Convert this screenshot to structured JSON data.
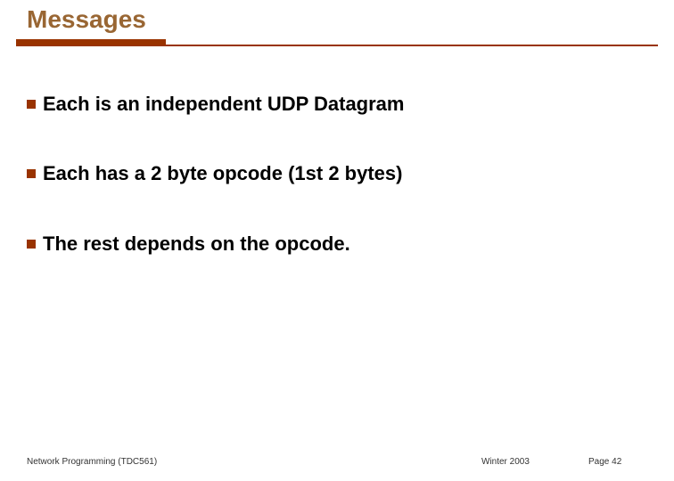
{
  "title": "Messages",
  "bullets": [
    "Each is an independent UDP Datagram",
    "Each has a 2 byte opcode (1st 2 bytes)",
    "The rest depends on the opcode."
  ],
  "footer": {
    "left": "Network Programming (TDC561)",
    "center": "Winter 2003",
    "right": "Page 42"
  }
}
